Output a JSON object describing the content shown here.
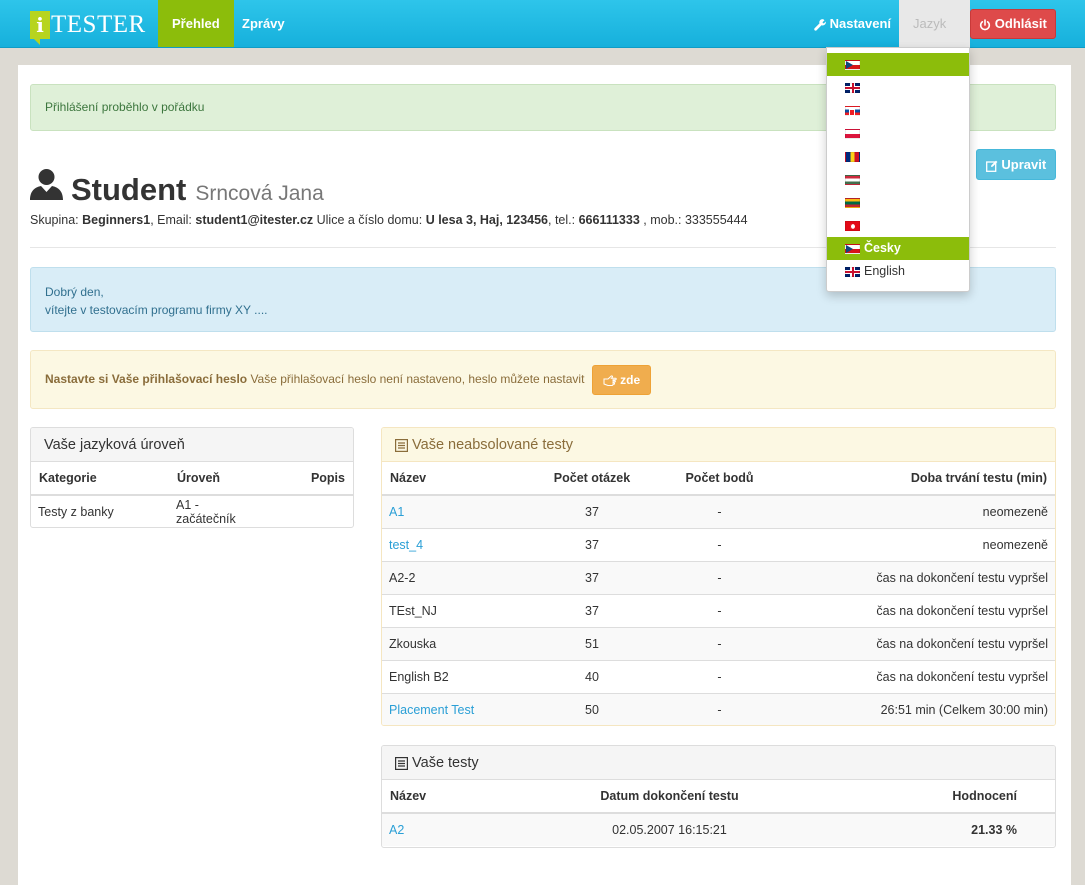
{
  "navbar": {
    "brand_letter": "i",
    "brand_text": "TESTER",
    "items": [
      {
        "label": "Přehled"
      },
      {
        "label": "Zprávy"
      }
    ],
    "settings_label": "Nastavení",
    "language_label": "Jazyk",
    "logout_label": "Odhlásit"
  },
  "language_menu": {
    "items": [
      {
        "flag": "cz",
        "label": ""
      },
      {
        "flag": "gb",
        "label": ""
      },
      {
        "flag": "sk",
        "label": ""
      },
      {
        "flag": "pl",
        "label": ""
      },
      {
        "flag": "ro",
        "label": ""
      },
      {
        "flag": "hu",
        "label": ""
      },
      {
        "flag": "lt",
        "label": ""
      },
      {
        "flag": "tr",
        "label": ""
      },
      {
        "flag": "cz",
        "label": "Česky"
      },
      {
        "flag": "gb",
        "label": "English"
      }
    ]
  },
  "alerts": {
    "success": "Přihlášení proběhlo v pořádku",
    "info_line1": "Dobrý den,",
    "info_line2": "vítejte v testovacím programu firmy XY ....",
    "warning_bold": "Nastavte si Vaše přihlašovací heslo",
    "warning_text": " Vaše přihlašovací heslo není nastaveno, heslo můžete nastavit ",
    "warning_button": "zde"
  },
  "profile": {
    "title": "Student",
    "name": "Srncová Jana",
    "edit_label": "Upravit",
    "group_label": "Skupina: ",
    "group": "Beginners1",
    "email_label": ", Email: ",
    "email": "student1@itester.cz",
    "address_label": " Ulice a číslo domu: ",
    "address": "U lesa 3, Haj, 123456",
    "tel_label": ", tel.: ",
    "tel": "666111333",
    "mob_label": " , mob.: ",
    "mob": "333555444"
  },
  "language_level": {
    "heading": "Vaše jazyková úroveň",
    "columns": [
      "Kategorie",
      "Úroveň",
      "Popis"
    ],
    "rows": [
      {
        "category": "Testy z banky",
        "level": "A1 - začátečník",
        "description": ""
      }
    ]
  },
  "pending_tests": {
    "heading": "Vaše neabsolované testy",
    "columns": [
      "Název",
      "Počet otázek",
      "Počet bodů",
      "Doba trvání testu (min)"
    ],
    "rows": [
      {
        "name": "A1",
        "link": true,
        "questions": "37",
        "points": "-",
        "duration": "neomezeně"
      },
      {
        "name": "test_4",
        "link": true,
        "questions": "37",
        "points": "-",
        "duration": "neomezeně"
      },
      {
        "name": "A2-2",
        "link": false,
        "questions": "37",
        "points": "-",
        "duration": "čas na dokončení testu vypršel"
      },
      {
        "name": "TEst_NJ",
        "link": false,
        "questions": "37",
        "points": "-",
        "duration": "čas na dokončení testu vypršel"
      },
      {
        "name": "Zkouska",
        "link": false,
        "questions": "51",
        "points": "-",
        "duration": "čas na dokončení testu vypršel"
      },
      {
        "name": "English B2",
        "link": false,
        "questions": "40",
        "points": "-",
        "duration": "čas na dokončení testu vypršel"
      },
      {
        "name": "Placement Test",
        "link": true,
        "questions": "50",
        "points": "-",
        "duration": "26:51 min (Celkem 30:00 min)"
      }
    ]
  },
  "my_tests": {
    "heading": "Vaše testy",
    "columns": [
      "Název",
      "Datum dokončení testu",
      "Hodnocení"
    ],
    "rows": [
      {
        "name": "A2",
        "date": "02.05.2007 16:15:21",
        "score": "21.33 %"
      }
    ]
  },
  "colors": {
    "navbar": "#1fb9e2",
    "active_green": "#8cbd0b",
    "danger": "#de4a4a",
    "info_button": "#5bc0de",
    "warning_button": "#f0ad4e",
    "link": "#2a9fd6"
  }
}
